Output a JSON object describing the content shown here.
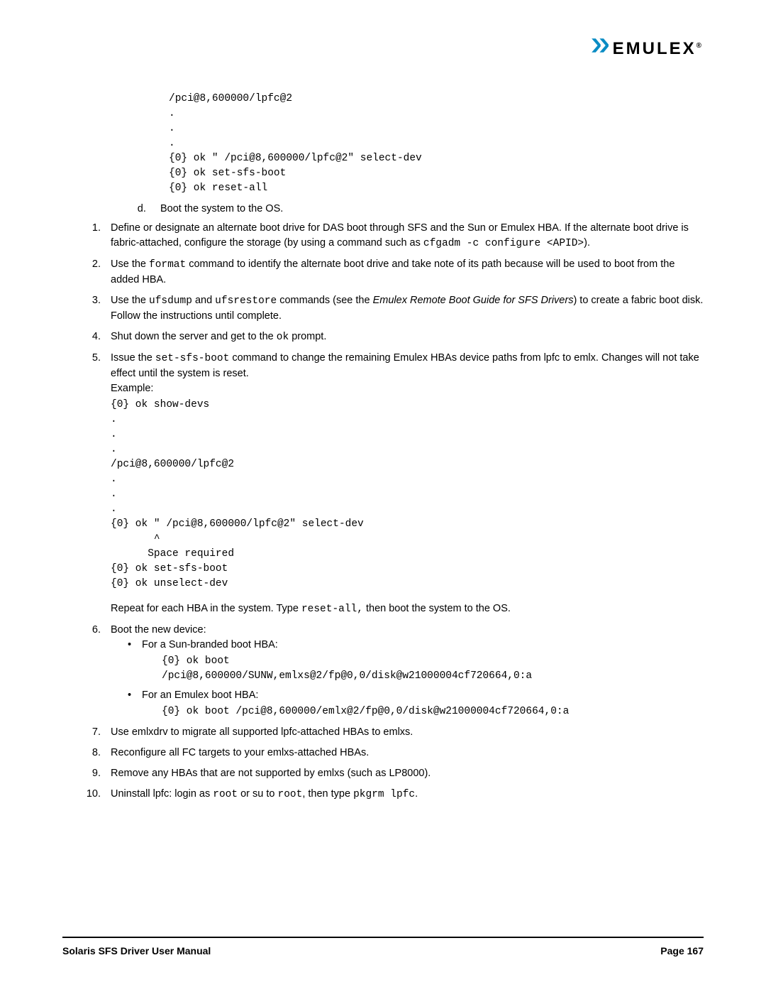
{
  "logo": {
    "brand": "EMULEX"
  },
  "pre_e": {
    "code1": "/pci@8,600000/lpfc@2\n.\n.\n.\n{0} ok \" /pci@8,600000/lpfc@2\" select-dev\n{0} ok set-sfs-boot\n{0} ok reset-all"
  },
  "step_e": "Boot the system to the OS.",
  "step6": {
    "t1": "Define or designate an alternate boot drive for DAS boot through SFS and the Sun or Emulex HBA. If the alternate boot drive is fabric-attached, configure the storage (by using a command such as ",
    "c1": "cfgadm -c configure <APID>",
    "t2": ")."
  },
  "step7": {
    "t1": "Use the ",
    "c1": "format",
    "t2": " command to identify the alternate boot drive and take note of its path because will be used to boot from the added HBA."
  },
  "step8": {
    "t1": "Use the ",
    "c1": "ufsdump",
    "t2": " and ",
    "c2": "ufsrestore",
    "t3": " commands (see the ",
    "i1": "Emulex Remote Boot Guide for SFS Drivers",
    "t4": ") to create a fabric boot disk. Follow the instructions until complete."
  },
  "step9": {
    "t1": "Shut down the server and get to the ",
    "c1": "ok",
    "t2": " prompt."
  },
  "step10": {
    "t1": "Issue the ",
    "c1": "set-sfs-boot",
    "t2": " command to change the remaining Emulex HBAs device paths from lpfc to emlx. Changes will not take effect until the system is reset.",
    "ex": "Example:",
    "code": "{0} ok show-devs\n.\n.\n.\n/pci@8,600000/lpfc@2\n.\n.\n.\n{0} ok \" /pci@8,600000/lpfc@2\" select-dev\n       ^\n      Space required\n{0} ok set-sfs-boot\n{0} ok unselect-dev",
    "after_t1": "Repeat for each HBA in the system. Type ",
    "after_c1": "reset-all,",
    "after_t2": " then boot the system to the OS."
  },
  "step11": {
    "t1": "Boot the new device:",
    "b1_t": "For a Sun-branded boot HBA:",
    "b1_c": "{0} ok boot\n/pci@8,600000/SUNW,emlxs@2/fp@0,0/disk@w21000004cf720664,0:a",
    "b2_t": "For an Emulex boot HBA:",
    "b2_c": "{0} ok boot /pci@8,600000/emlx@2/fp@0,0/disk@w21000004cf720664,0:a"
  },
  "step12": "Use emlxdrv to migrate all supported lpfc-attached HBAs to emlxs.",
  "step13": "Reconfigure all FC targets to your emlxs-attached HBAs.",
  "step14": "Remove any HBAs that are not supported by emlxs (such as LP8000).",
  "step15": {
    "t1": "Uninstall lpfc: login as ",
    "c1": "root",
    "t2": " or su to ",
    "c2": "root",
    "t3": ", then type ",
    "c3": "pkgrm lpfc",
    "t4": "."
  },
  "footer": {
    "left": "Solaris SFS Driver User Manual",
    "right": "Page 167"
  }
}
